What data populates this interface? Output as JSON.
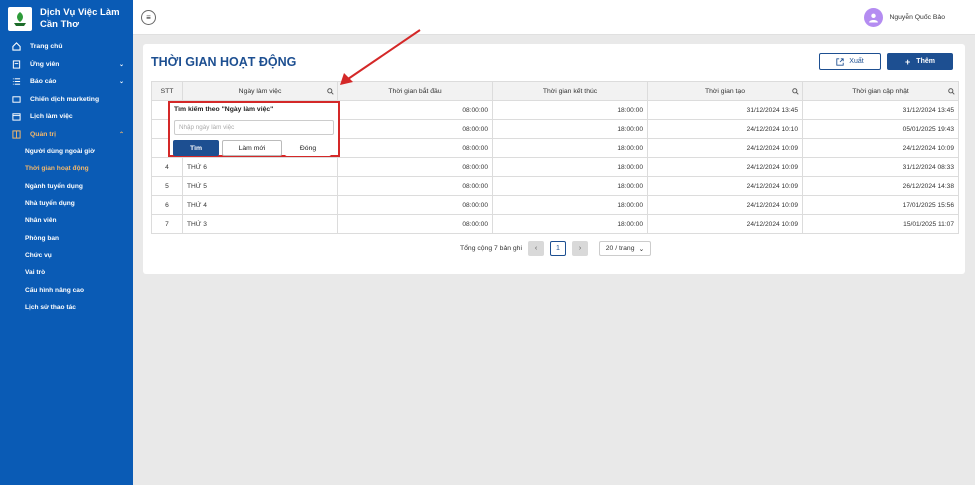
{
  "brand": {
    "name_line1": "Dịch Vụ Việc Làm",
    "name_line2": "Cần Thơ"
  },
  "sidebar": {
    "items": [
      {
        "label": "Trang chủ",
        "icon": "home-icon"
      },
      {
        "label": "Ứng viên",
        "icon": "candidate-icon"
      },
      {
        "label": "Báo cáo",
        "icon": "list-icon"
      },
      {
        "label": "Chiến dịch marketing",
        "icon": "campaign-icon"
      },
      {
        "label": "Lịch làm việc",
        "icon": "calendar-icon"
      },
      {
        "label": "Quản trị",
        "icon": "admin-icon"
      }
    ],
    "sub_items": [
      {
        "label": "Người dùng ngoài giờ"
      },
      {
        "label": "Thời gian hoạt động"
      },
      {
        "label": "Ngành tuyển dụng"
      },
      {
        "label": "Nhà tuyển dụng"
      },
      {
        "label": "Nhân viên"
      },
      {
        "label": "Phòng ban"
      },
      {
        "label": "Chức vụ"
      },
      {
        "label": "Vai trò"
      },
      {
        "label": "Cấu hình nâng cao"
      },
      {
        "label": "Lịch sử thao tác"
      }
    ]
  },
  "header": {
    "user_name": "Nguyễn Quốc Bảo"
  },
  "page": {
    "title": "THỜI GIAN HOẠT ĐỘNG",
    "export_label": "Xuất",
    "add_label": "Thêm"
  },
  "table": {
    "columns": [
      "STT",
      "Ngày làm việc",
      "Thời gian bắt đầu",
      "Thời gian kết thúc",
      "Thời gian tạo",
      "Thời gian cập nhật"
    ],
    "rows": [
      {
        "stt": "",
        "day": "",
        "start": "08:00:00",
        "end": "18:00:00",
        "created": "31/12/2024 13:45",
        "updated": "31/12/2024 13:45"
      },
      {
        "stt": "",
        "day": "",
        "start": "08:00:00",
        "end": "18:00:00",
        "created": "24/12/2024 10:10",
        "updated": "05/01/2025 19:43"
      },
      {
        "stt": "",
        "day": "",
        "start": "08:00:00",
        "end": "18:00:00",
        "created": "24/12/2024 10:09",
        "updated": "24/12/2024 10:09"
      },
      {
        "stt": "4",
        "day": "THỨ 6",
        "start": "08:00:00",
        "end": "18:00:00",
        "created": "24/12/2024 10:09",
        "updated": "31/12/2024 08:33"
      },
      {
        "stt": "5",
        "day": "THỨ 5",
        "start": "08:00:00",
        "end": "18:00:00",
        "created": "24/12/2024 10:09",
        "updated": "26/12/2024 14:38"
      },
      {
        "stt": "6",
        "day": "THỨ 4",
        "start": "08:00:00",
        "end": "18:00:00",
        "created": "24/12/2024 10:09",
        "updated": "17/01/2025 15:56"
      },
      {
        "stt": "7",
        "day": "THỨ 3",
        "start": "08:00:00",
        "end": "18:00:00",
        "created": "24/12/2024 10:09",
        "updated": "15/01/2025 11:07"
      }
    ]
  },
  "pagination": {
    "total_label": "Tổng cộng 7 bản ghi",
    "current_page": "1",
    "page_size": "20 / trang",
    "prev": "‹",
    "next": "›"
  },
  "filter_popup": {
    "title": "Tìm kiếm theo \"Ngày làm việc\"",
    "placeholder": "Nhập ngày làm việc",
    "search_label": "Tìm",
    "reset_label": "Làm mới",
    "close_label": "Đóng"
  },
  "colors": {
    "sidebar": "#0a5bb5",
    "primary": "#1d4f91",
    "active": "#f5b86a",
    "annotation": "#d42828"
  }
}
